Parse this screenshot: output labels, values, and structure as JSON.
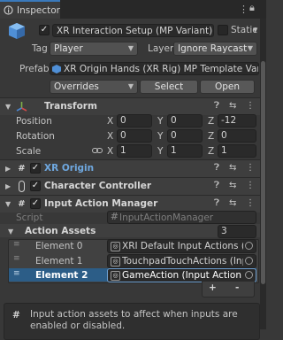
{
  "tab": {
    "title": "Inspector"
  },
  "header": {
    "object_name": "XR Interaction Setup (MP Variant)",
    "static_label": "Static",
    "tag_label": "Tag",
    "tag_value": "Player",
    "layer_label": "Layer",
    "layer_value": "Ignore Raycast",
    "prefab_label": "Prefab",
    "prefab_value": "XR Origin Hands (XR Rig) MP Template Variant",
    "overrides_label": "Overrides",
    "select_label": "Select",
    "open_label": "Open"
  },
  "transform": {
    "title": "Transform",
    "rows": [
      {
        "label": "Position",
        "x": "0",
        "y": "0",
        "z": "-12"
      },
      {
        "label": "Rotation",
        "x": "0",
        "y": "0",
        "z": "0"
      },
      {
        "label": "Scale",
        "x": "1",
        "y": "1",
        "z": "1"
      }
    ],
    "axis": {
      "x": "X",
      "y": "Y",
      "z": "Z"
    }
  },
  "components": {
    "xr_origin": "XR Origin",
    "character_controller": "Character Controller",
    "input_action_manager": "Input Action Manager"
  },
  "input_action_manager": {
    "script_label": "Script",
    "script_value": "InputActionManager",
    "action_assets_label": "Action Assets",
    "action_assets_count": "3",
    "elements": [
      {
        "label": "Element 0",
        "value": "XRI Default Input Actions (Input"
      },
      {
        "label": "Element 1",
        "value": "TouchpadTouchActions (Input"
      },
      {
        "label": "Element 2",
        "value": "GameAction (Input Action As"
      }
    ],
    "add_label": "+",
    "remove_label": "-",
    "help_text": "Input action assets to affect when inputs are enabled or disabled."
  },
  "colors": {
    "accent": "#3a79bb",
    "selected_row": "#2c5d87",
    "background": "#383838"
  }
}
